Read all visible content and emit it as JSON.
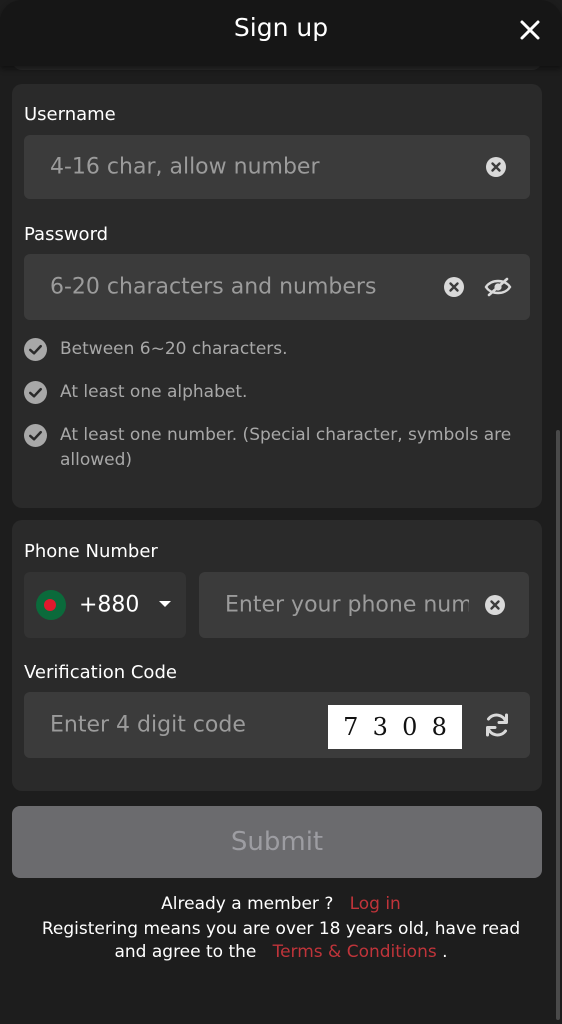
{
  "header": {
    "title": "Sign up"
  },
  "username": {
    "label": "Username",
    "placeholder": "4-16 char, allow number"
  },
  "password": {
    "label": "Password",
    "placeholder": "6-20 characters and numbers",
    "rules": [
      "Between 6~20 characters.",
      "At least one alphabet.",
      "At least one number. (Special character, symbols are allowed)"
    ]
  },
  "phone": {
    "label": "Phone Number",
    "country_code": "+880",
    "placeholder": "Enter your phone number"
  },
  "verification": {
    "label": "Verification Code",
    "placeholder": "Enter 4 digit code",
    "captcha_digits": [
      "7",
      "3",
      "0",
      "8"
    ]
  },
  "submit": {
    "label": "Submit"
  },
  "footer": {
    "member_text": "Already a member ?",
    "login_link": "Log in",
    "terms_text": "Registering means you are over 18 years old, have read and agree to the",
    "terms_link": "Terms & Conditions",
    "terms_end": "."
  },
  "colors": {
    "background": "#1d1d1d",
    "card": "#2a2a2a",
    "field": "#3b3b3b",
    "link": "#c0343a",
    "submit_disabled": "#6b6b6e"
  },
  "icons": [
    "close-icon",
    "clear-icon",
    "eye-off-icon",
    "check-circle-icon",
    "caret-down-icon",
    "refresh-icon",
    "flag-bangladesh-icon"
  ]
}
